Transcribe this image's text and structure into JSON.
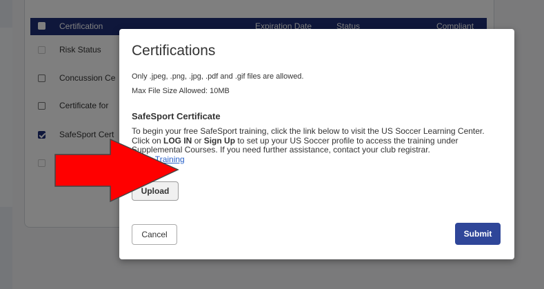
{
  "table": {
    "headers": {
      "certification": "Certification",
      "expiration_date": "Expiration Date",
      "status": "Status",
      "compliant": "Compliant"
    },
    "rows": [
      {
        "label": "Risk Status",
        "checked": false
      },
      {
        "label": "Concussion Ce",
        "checked": false
      },
      {
        "label": "Certificate for",
        "checked": false
      },
      {
        "label": "SafeSport Cert",
        "checked": true
      },
      {
        "label": "",
        "checked": false
      }
    ]
  },
  "modal": {
    "title": "Certifications",
    "file_types": "Only .jpeg, .png, .jpg, .pdf and .gif files are allowed.",
    "max_size": "Max File Size Allowed: 10MB",
    "section_title": "SafeSport Certificate",
    "instructions": {
      "part1": "To begin your free SafeSport training, click the link below to visit the US Soccer Learning Center. Click on ",
      "log_in": "LOG IN",
      "or": " or ",
      "sign_up": "Sign Up",
      "part2": " to set up your US Soccer profile to access the training under Supplemental Courses. If you need further assistance, contact your club registrar."
    },
    "begin_training": "Begin Training",
    "upload_label": "Upload",
    "cancel_label": "Cancel",
    "submit_label": "Submit"
  },
  "colors": {
    "header_navy": "#1f2f76",
    "submit_blue": "#2f4699",
    "link_blue": "#2a62c9",
    "arrow_red": "#ff0000"
  }
}
